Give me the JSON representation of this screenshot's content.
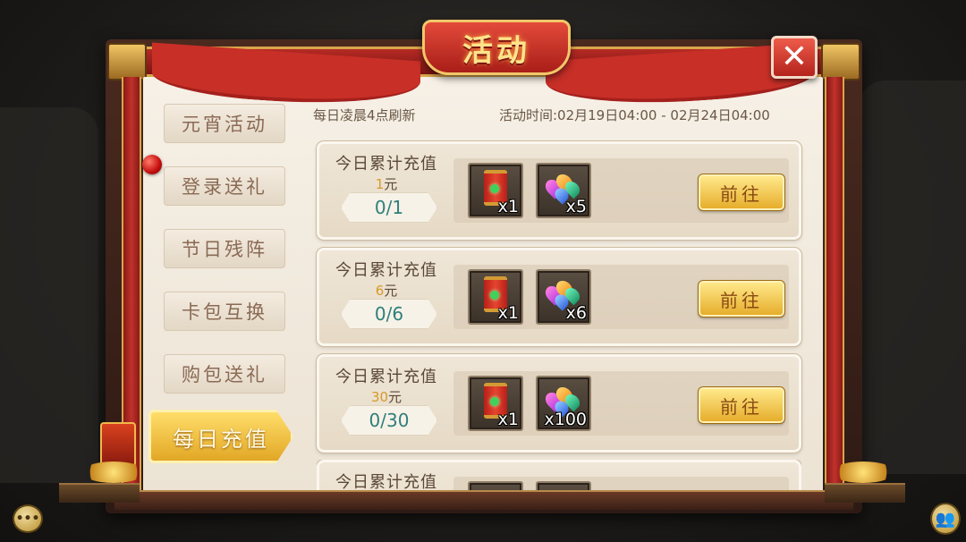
{
  "title": "活动",
  "tabs": [
    {
      "label": "元宵活动",
      "active": false
    },
    {
      "label": "登录送礼",
      "active": false,
      "has_notification": true
    },
    {
      "label": "节日残阵",
      "active": false
    },
    {
      "label": "卡包互换",
      "active": false
    },
    {
      "label": "购包送礼",
      "active": false
    },
    {
      "label": "每日充值",
      "active": true
    }
  ],
  "header": {
    "refresh_note": "每日凌晨4点刷新",
    "activity_time": "活动时间:02月19日04:00 - 02月24日04:00"
  },
  "rewards": [
    {
      "title": "今日累计充值",
      "amount": "1",
      "unit": "元",
      "progress": "0/1",
      "items": [
        {
          "icon": "red-scroll-icon",
          "qty": "x1"
        },
        {
          "icon": "gem-pile-icon",
          "qty": "x5"
        }
      ],
      "button": "前往"
    },
    {
      "title": "今日累计充值",
      "amount": "6",
      "unit": "元",
      "progress": "0/6",
      "items": [
        {
          "icon": "red-scroll-icon",
          "qty": "x1"
        },
        {
          "icon": "gem-pile-icon",
          "qty": "x6"
        }
      ],
      "button": "前往"
    },
    {
      "title": "今日累计充值",
      "amount": "30",
      "unit": "元",
      "progress": "0/30",
      "items": [
        {
          "icon": "red-scroll-icon",
          "qty": "x1"
        },
        {
          "icon": "gem-pile-icon",
          "qty": "x100"
        }
      ],
      "button": "前往"
    },
    {
      "title": "今日累计充值"
    }
  ],
  "icons": {
    "close": "close-icon",
    "chat": "chat-icon",
    "friends": "friends-icon"
  },
  "colors": {
    "accent_gold": "#e6ae2c",
    "banner_red": "#c72f27",
    "progress_teal": "#2f7f7a",
    "amount_orange": "#d69a2a"
  }
}
